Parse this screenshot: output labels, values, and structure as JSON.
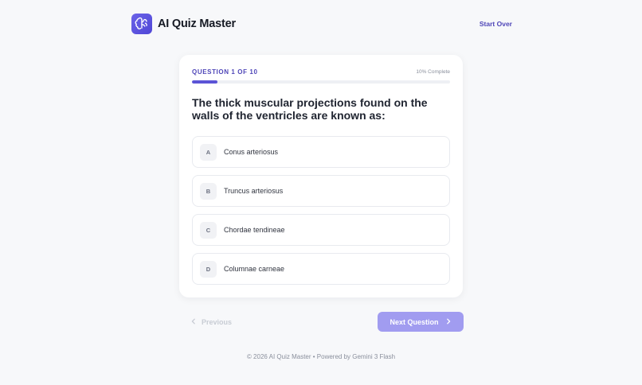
{
  "header": {
    "app_title": "AI Quiz Master",
    "start_over_label": "Start Over",
    "logo_icon": "brain-icon",
    "accent_color": "#5b54d6"
  },
  "quiz": {
    "question_label": "QUESTION 1 OF 10",
    "progress_label": "10% Complete",
    "progress_fraction": 0.1,
    "question_text": "The thick muscular projections found on the walls of the ventricles are known as:",
    "options": [
      {
        "letter": "A",
        "text": "Conus arteriosus"
      },
      {
        "letter": "B",
        "text": "Truncus arteriosus"
      },
      {
        "letter": "C",
        "text": "Chordae tendineae"
      },
      {
        "letter": "D",
        "text": "Columnae carneae"
      }
    ]
  },
  "nav": {
    "previous_label": "Previous",
    "next_label": "Next Question",
    "previous_icon": "chevron-left-icon",
    "next_icon": "chevron-right-icon"
  },
  "footer": {
    "text": "© 2026 AI Quiz Master • Powered by Gemini 3 Flash"
  }
}
